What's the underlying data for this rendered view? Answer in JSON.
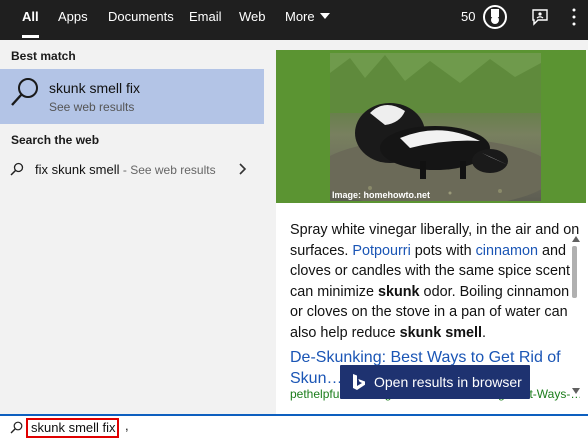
{
  "tabs": [
    {
      "label": "All",
      "active": true
    },
    {
      "label": "Apps"
    },
    {
      "label": "Documents"
    },
    {
      "label": "Email"
    },
    {
      "label": "Web"
    },
    {
      "label": "More"
    }
  ],
  "toolbar": {
    "points": "50",
    "icons": [
      "rewards-medal-icon",
      "feedback-icon",
      "more-options-ellipsis-icon"
    ]
  },
  "best_match": {
    "heading": "Best match",
    "title": "skunk smell fix",
    "subtitle": "See web results",
    "selected_color": "#b3c4e6"
  },
  "search_web": {
    "heading": "Search the web",
    "item": {
      "query": "fix skunk smell",
      "suffix": " - See web results"
    }
  },
  "preview": {
    "image_caption": "Image: homehowto.net",
    "answer": {
      "t1": "Spray white vinegar liberally, in the air and on surfaces. ",
      "l1": "Potpourri",
      "t2": " pots with ",
      "l2": "cinnamon",
      "t3": " and cloves or candles with the same spice scent can minimize ",
      "b1": "skunk",
      "t4": " odor. Boiling cinnamon or cloves on the stove in a pan of water can also help reduce ",
      "b2": "skunk smell",
      "t5": "."
    },
    "result_title": "De-Skunking: Best Ways to Get Rid of Skun…",
    "result_url": "pethelpful.com/dogs/About-De-Skunking-Best-Ways-…",
    "open_button": "Open results in browser"
  },
  "search_box": {
    "value": "skunk smell fix",
    "trailing": ","
  },
  "colors": {
    "topbar": "#1f1f1f",
    "accent_blue": "#1e3270",
    "link": "#1a55b5",
    "url_green": "#1b7d1b",
    "highlight_red": "#e00000"
  }
}
